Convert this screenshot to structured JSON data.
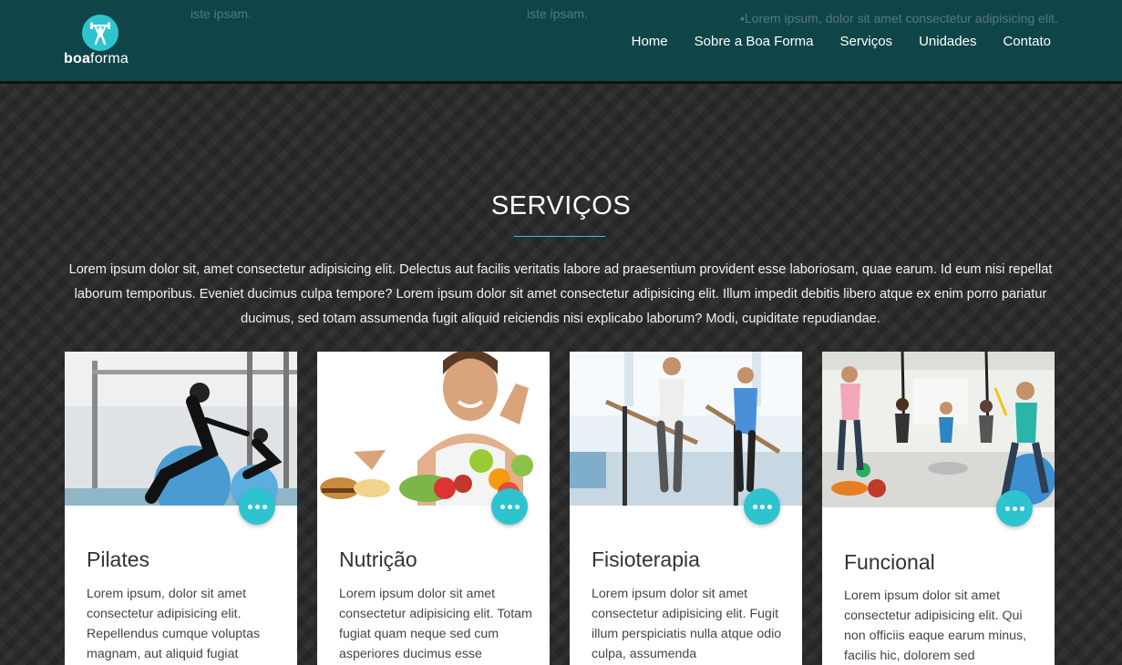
{
  "header": {
    "logo": {
      "brand_bold": "boa",
      "brand_light": "forma",
      "icon": "weightlifter-icon"
    },
    "ghost_texts": [
      "iste ipsam.",
      "iste ipsam.",
      "•Lorem ipsum, dolor sit amet consectetur adipisicing elit."
    ],
    "nav": [
      "Home",
      "Sobre a Boa Forma",
      "Serviços",
      "Unidades",
      "Contato"
    ]
  },
  "section": {
    "title": "SERVIÇOS",
    "intro": "Lorem ipsum dolor sit, amet consectetur adipisicing elit. Delectus aut facilis veritatis labore ad praesentium provident esse laboriosam, quae earum. Id eum nisi repellat laborum temporibus. Eveniet ducimus culpa tempore? Lorem ipsum dolor sit amet consectetur adipisicing elit. Illum impedit debitis libero atque ex enim porro pariatur ducimus, sed totam assumenda fugit aliquid reiciendis nisi explicabo laborum? Modi, cupiditate repudiandae."
  },
  "cards": [
    {
      "title": "Pilates",
      "text": "Lorem ipsum, dolor sit amet consectetur adipisicing elit. Repellendus cumque voluptas magnam, aut aliquid fugiat",
      "image": "pilates-photo"
    },
    {
      "title": "Nutrição",
      "text": "Lorem ipsum dolor sit amet consectetur adipisicing elit. Totam fugiat quam neque sed cum asperiores ducimus esse",
      "image": "nutrition-photo"
    },
    {
      "title": "Fisioterapia",
      "text": "Lorem ipsum dolor sit amet consectetur adipisicing elit. Fugit illum perspiciatis nulla atque odio culpa, assumenda",
      "image": "physiotherapy-photo"
    },
    {
      "title": "Funcional",
      "text": "Lorem ipsum dolor sit amet consectetur adipisicing elit. Qui non officiis eaque earum minus, facilis hic, dolorem sed",
      "image": "functional-training-photo"
    }
  ],
  "colors": {
    "header_bg": "#0f4548",
    "accent": "#2ec4cf",
    "page_bg": "#2a2a2a",
    "card_bg": "#ffffff"
  }
}
